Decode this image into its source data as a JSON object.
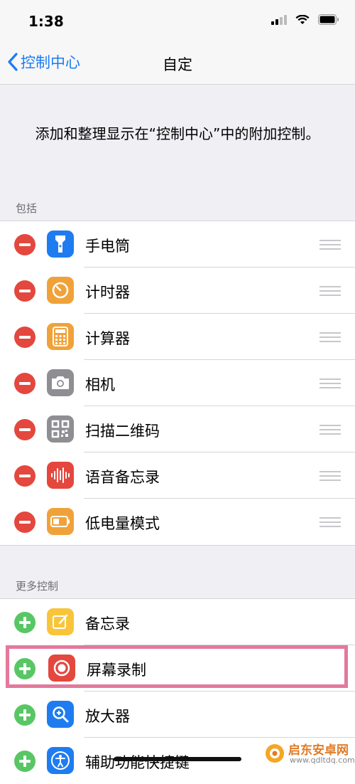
{
  "status_bar": {
    "time": "1:38"
  },
  "nav": {
    "back_label": "控制中心",
    "title": "自定"
  },
  "intro": "添加和整理显示在“控制中心”中的附加控制。",
  "included": {
    "header": "包括",
    "items": [
      {
        "label": "手电筒",
        "icon": "flashlight-icon",
        "color": "#1e7cf0"
      },
      {
        "label": "计时器",
        "icon": "timer-icon",
        "color": "#f0a23a"
      },
      {
        "label": "计算器",
        "icon": "calculator-icon",
        "color": "#f0a23a"
      },
      {
        "label": "相机",
        "icon": "camera-icon",
        "color": "#8e8e93"
      },
      {
        "label": "扫描二维码",
        "icon": "qr-code-icon",
        "color": "#8e8e93"
      },
      {
        "label": "语音备忘录",
        "icon": "voice-memo-icon",
        "color": "#e4473d"
      },
      {
        "label": "低电量模式",
        "icon": "battery-icon",
        "color": "#f0a23a"
      }
    ]
  },
  "more": {
    "header": "更多控制",
    "items": [
      {
        "label": "备忘录",
        "icon": "notes-icon",
        "color": "#f8c53a"
      },
      {
        "label": "屏幕录制",
        "icon": "screen-record-icon",
        "color": "#e4473d",
        "highlighted": true
      },
      {
        "label": "放大器",
        "icon": "magnifier-icon",
        "color": "#1e7cf0"
      },
      {
        "label": "辅助功能快捷键",
        "icon": "accessibility-icon",
        "color": "#1e7cf0"
      }
    ]
  },
  "watermark": {
    "text": "启东安卓网",
    "url": "www.qdltdq.com"
  }
}
